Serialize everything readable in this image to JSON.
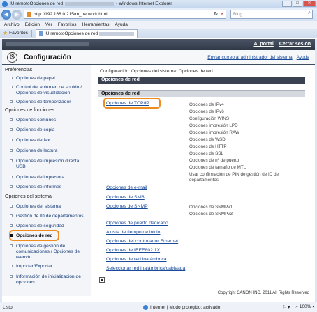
{
  "window": {
    "title_prefix": "IU remotoOpciones de red",
    "title_suffix": "- Windows Internet Explorer",
    "minimize": "–",
    "maximize": "□",
    "close": "✕"
  },
  "addressbar": {
    "back": "◀",
    "forward": "▶",
    "url": "http://192.168.0.215/m_network.html",
    "refresh": "↻",
    "stop": "✕",
    "search_placeholder": "Bing"
  },
  "menu": [
    "Archivo",
    "Edición",
    "Ver",
    "Favoritos",
    "Herramientas",
    "Ayuda"
  ],
  "favorites": {
    "label": "Favoritos",
    "tab_label": "IU remotoOpciones de red"
  },
  "device_bar": {
    "portal_link": "Al portal",
    "logout_link": "Cerrar sesión"
  },
  "header": {
    "title": "Configuración",
    "email_link": "Enviar correo al administrador del sistema",
    "help_link": "Ayuda"
  },
  "sidebar": {
    "sections": [
      {
        "title": "Preferencias",
        "items": [
          "Opciones de papel",
          "Control del volumen de sonido / Opciones de visualización",
          "Opciones de temporizador"
        ]
      },
      {
        "title": "Opciones de funciones",
        "items": [
          "Opciones comunes",
          "Opciones de copia",
          "Opciones de fax",
          "Opciones de lectura",
          "Opciones de impresión directa USB",
          "Opciones de impresora",
          "Opciones de informes"
        ]
      },
      {
        "title": "Opciones del sistema",
        "items": [
          "Opciones del sistema",
          "Gestión de ID de departamentos",
          "Opciones de seguridad",
          "Opciones de red",
          "Opciones de gestión de comunicaciones / Opciones de reenvío",
          "Importar/Exportar",
          "Información de inicialización de opciones"
        ]
      }
    ]
  },
  "main": {
    "breadcrumb": "Configuración: Opciones del sistema: Opciones de red",
    "section_title": "Opciones de red",
    "subsection_title": "Opciones de red",
    "tcpip_link": "Opciones de TCP/IP",
    "tcpip_details": [
      "Opciones de IPv4",
      "Opciones de IPv6",
      "Configuración WINS",
      "Opciones impresión LPD",
      "Opciones impresión RAW",
      "Opciones de WSD",
      "Opciones de HTTP",
      "Opciones de SSL",
      "Opciones de nº de puerto",
      "Opciones de tamaño de MTU",
      "Usar confirmación de PIN de gestión de ID de departamentos"
    ],
    "email_link": "Opciones de e-mail",
    "smb_link": "Opciones de SMB",
    "snmp_link": "Opciones de SNMP",
    "snmp_details": [
      "Opciones de SNMPv1",
      "Opciones de SNMPv3"
    ],
    "other_links": [
      "Opciones de puerto dedicado",
      "Ajuste de tiempo de inicio",
      "Opciones del controlador Ethernet",
      "Opciones de IEEE802.1X",
      "Opciones de red inalámbrica",
      "Seleccionar red inalámbrica/cableada"
    ],
    "top_icon": "▲",
    "copyright": "Copyright CANON INC. 2011 All Rights Reserved"
  },
  "statusbar": {
    "left": "Listo",
    "zone": "Internet | Modo protegido: activado",
    "zoom": "100%"
  }
}
